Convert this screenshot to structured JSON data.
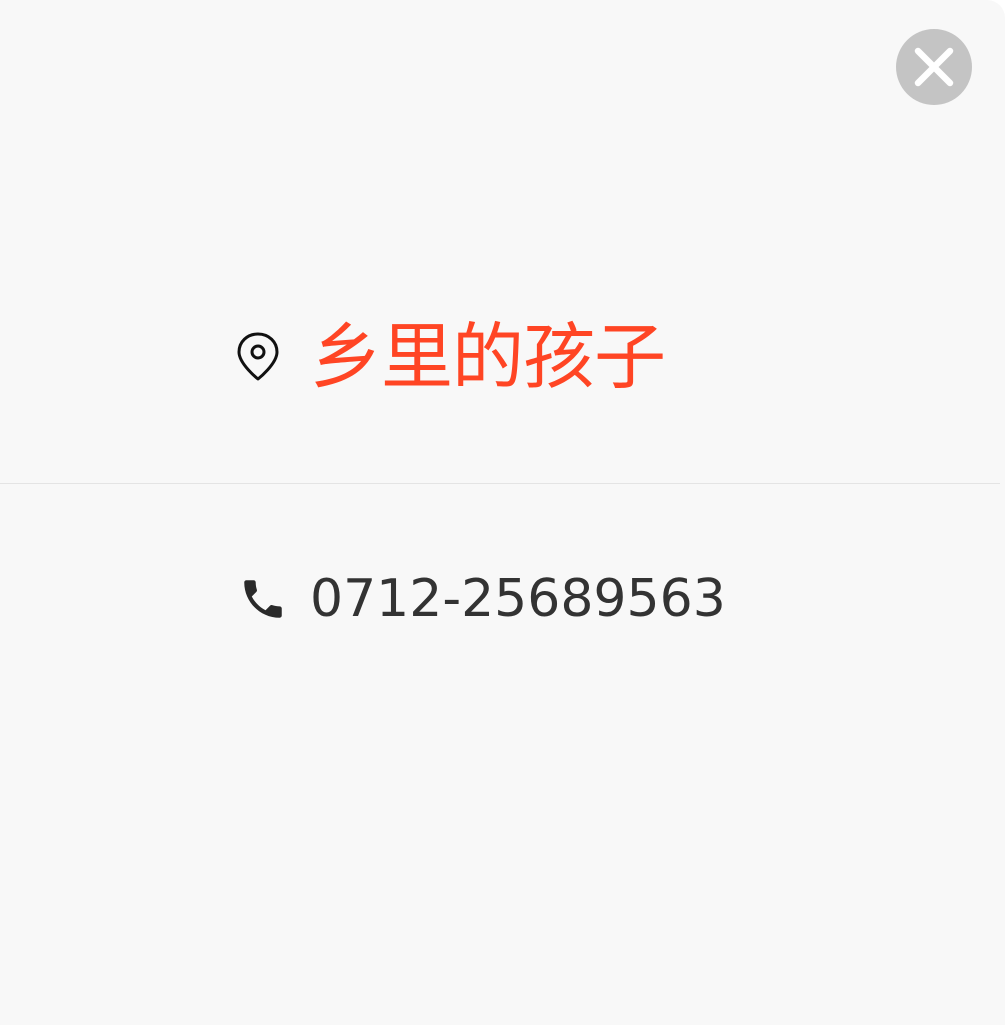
{
  "dialog": {
    "close_icon": "close-icon",
    "shop": {
      "icon": "location-pin-icon",
      "name": "乡里的孩子",
      "color": "#ff4524"
    },
    "phone": {
      "icon": "phone-icon",
      "number": "0712-25689563",
      "color": "#333333"
    }
  }
}
